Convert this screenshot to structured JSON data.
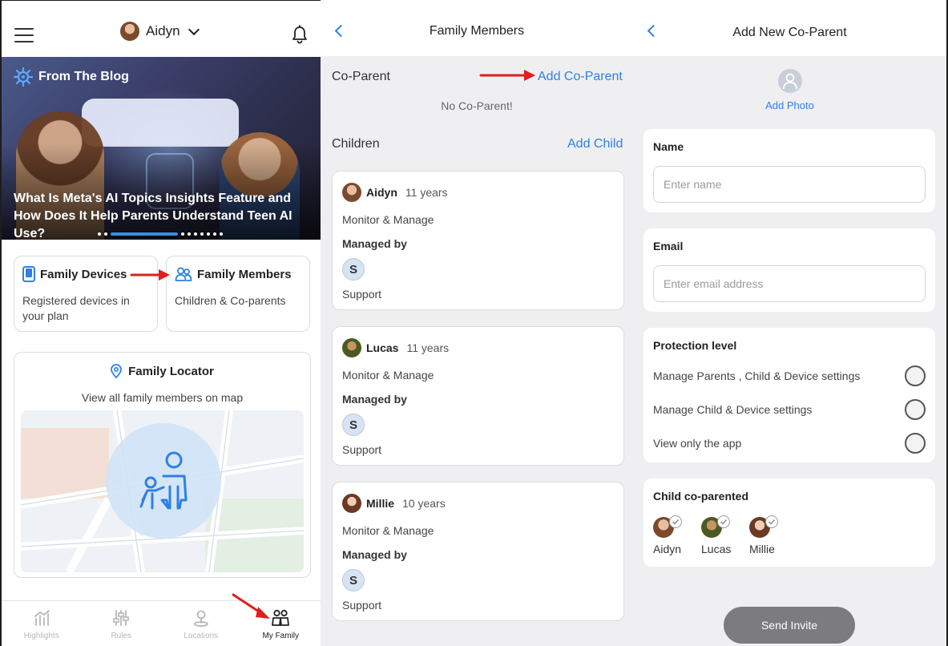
{
  "panel1": {
    "header": {
      "user_name": "Aidyn"
    },
    "blog": {
      "tag": "From The Blog",
      "title": "What Is Meta's AI Topics Insights Feature and How Does It Help Parents Understand Teen AI Use?"
    },
    "cards": {
      "devices": {
        "title": "Family Devices",
        "subtitle": "Registered devices in your plan"
      },
      "members": {
        "title": "Family Members",
        "subtitle": "Children & Co-parents"
      }
    },
    "locator": {
      "title": "Family Locator",
      "subtitle": "View all family members on map"
    },
    "tabbar": {
      "items": [
        {
          "label": "Highlights",
          "icon": "chart-icon"
        },
        {
          "label": "Rules",
          "icon": "sliders-icon"
        },
        {
          "label": "Locations",
          "icon": "location-icon"
        },
        {
          "label": "My Family",
          "icon": "family-icon"
        }
      ],
      "active": "My Family"
    }
  },
  "panel2": {
    "title": "Family Members",
    "coparent": {
      "label": "Co-Parent",
      "action": "Add Co-Parent",
      "empty": "No Co-Parent!"
    },
    "children_section": {
      "label": "Children",
      "action": "Add Child"
    },
    "children": [
      {
        "name": "Aidyn",
        "age": "11 years",
        "monitor": "Monitor & Manage",
        "managed_by_label": "Managed by",
        "manager_initial": "S",
        "manager_name": "Support"
      },
      {
        "name": "Lucas",
        "age": "11 years",
        "monitor": "Monitor & Manage",
        "managed_by_label": "Managed by",
        "manager_initial": "S",
        "manager_name": "Support"
      },
      {
        "name": "Millie",
        "age": "10 years",
        "monitor": "Monitor & Manage",
        "managed_by_label": "Managed by",
        "manager_initial": "S",
        "manager_name": "Support"
      }
    ]
  },
  "panel3": {
    "title": "Add New Co-Parent",
    "add_photo": "Add Photo",
    "name": {
      "label": "Name",
      "placeholder": "Enter name",
      "value": ""
    },
    "email": {
      "label": "Email",
      "placeholder": "Enter email address",
      "value": ""
    },
    "protection": {
      "label": "Protection level",
      "options": [
        "Manage Parents , Child & Device settings",
        "Manage Child & Device settings",
        "View only the app"
      ]
    },
    "coparented": {
      "label": "Child co-parented",
      "children": [
        "Aidyn",
        "Lucas",
        "Millie"
      ]
    },
    "send_button": "Send Invite"
  },
  "colors": {
    "accent_blue": "#2f80e4",
    "annotation_red": "#e01e1e",
    "send_button_bg": "#7c7c80"
  }
}
